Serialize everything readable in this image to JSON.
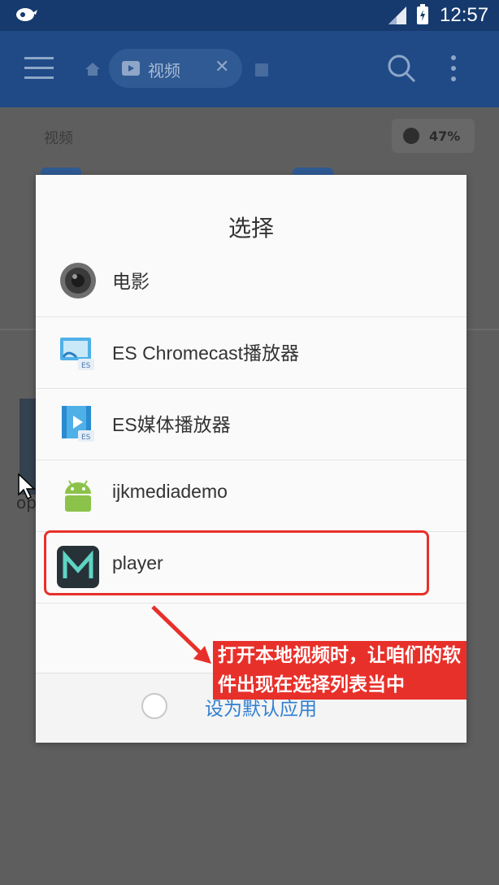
{
  "status_bar": {
    "time": "12:57"
  },
  "app_bar": {
    "tab_label": "视频",
    "tab_close": "✕"
  },
  "background": {
    "breadcrumb": "视频",
    "storage_percent": "47%",
    "file_name_partial": "op"
  },
  "dialog": {
    "title": "选择",
    "apps": [
      {
        "label": "电影",
        "icon": "camera-lens-icon"
      },
      {
        "label": "ES Chromecast播放器",
        "icon": "cast-screen-icon"
      },
      {
        "label": "ES媒体播放器",
        "icon": "media-player-icon"
      },
      {
        "label": "ijkmediademo",
        "icon": "android-icon"
      },
      {
        "label": "player",
        "icon": "m-logo-icon"
      }
    ],
    "footer_label": "设为默认应用"
  },
  "annotation": {
    "text": "打开本地视频时，让咱们的软件出现在选择列表当中"
  },
  "colors": {
    "highlight": "#e8302a",
    "appbar": "#1f4a86",
    "statusbar": "#163a6e",
    "link": "#2f7fd0"
  }
}
